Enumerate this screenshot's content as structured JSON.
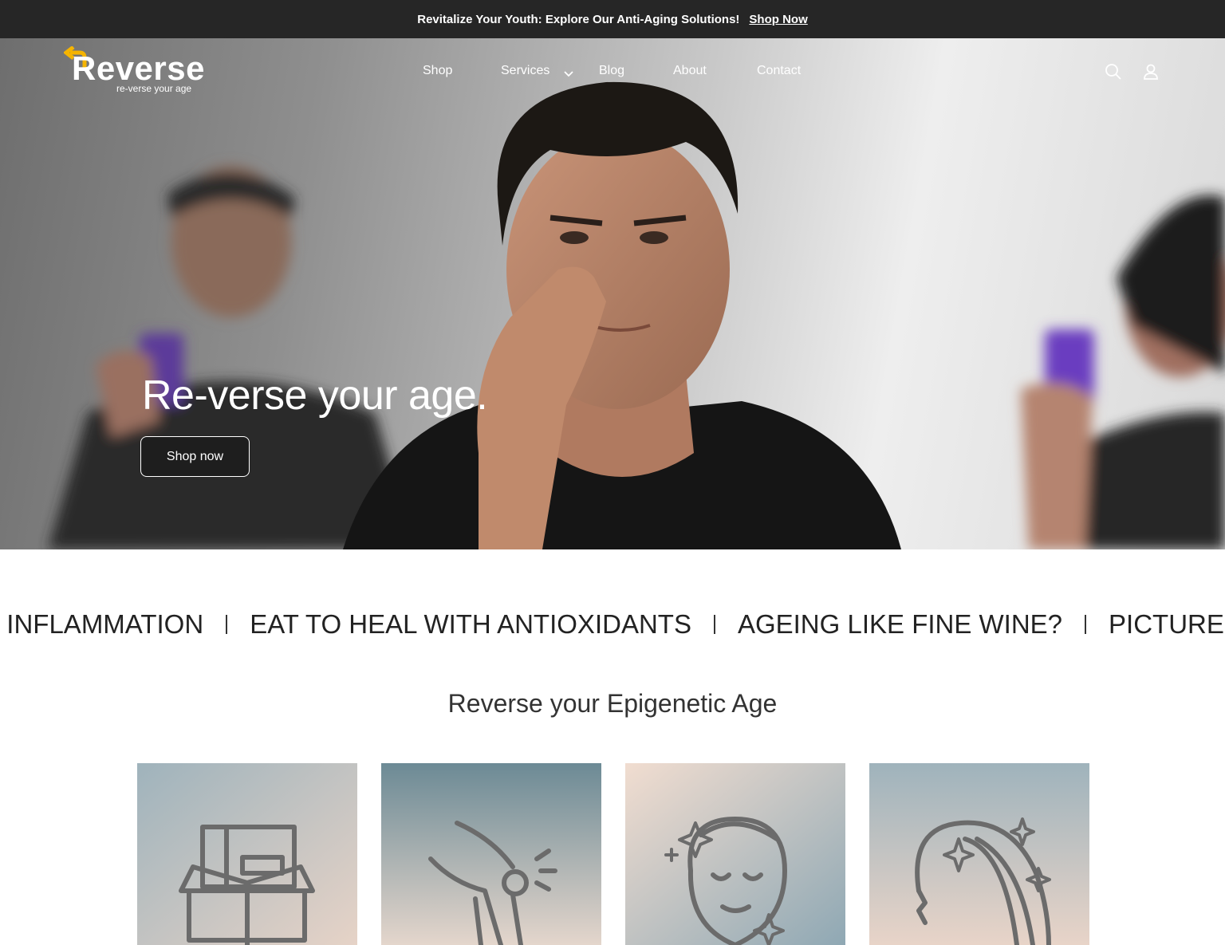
{
  "announcement": {
    "text": "Revitalize Your Youth: Explore Our Anti-Aging Solutions!",
    "link_label": "Shop Now"
  },
  "header": {
    "logo_word": "Reverse",
    "logo_tagline": "re-verse your age",
    "nav": [
      "Shop",
      "Services",
      "Blog",
      "About",
      "Contact"
    ],
    "icons": [
      "search-icon",
      "account-icon",
      "chevron-down-icon"
    ]
  },
  "hero": {
    "title": "Re-verse your age.",
    "button_label": "Shop now"
  },
  "marquee": {
    "items": [
      "L INFLAMMATION",
      "EAT TO HEAL WITH ANTIOXIDANTS",
      "AGEING LIKE FINE WINE?",
      "PICTURE OF H"
    ]
  },
  "section": {
    "title": "Reverse your Epigenetic Age"
  },
  "cards": {
    "icons": [
      "box-products-icon",
      "knee-joint-icon",
      "face-skin-icon",
      "hair-icon"
    ]
  },
  "colors": {
    "announcement_bg": "#262626",
    "logo_accent": "#f5b400",
    "button_bg": "#1e1e1e"
  }
}
